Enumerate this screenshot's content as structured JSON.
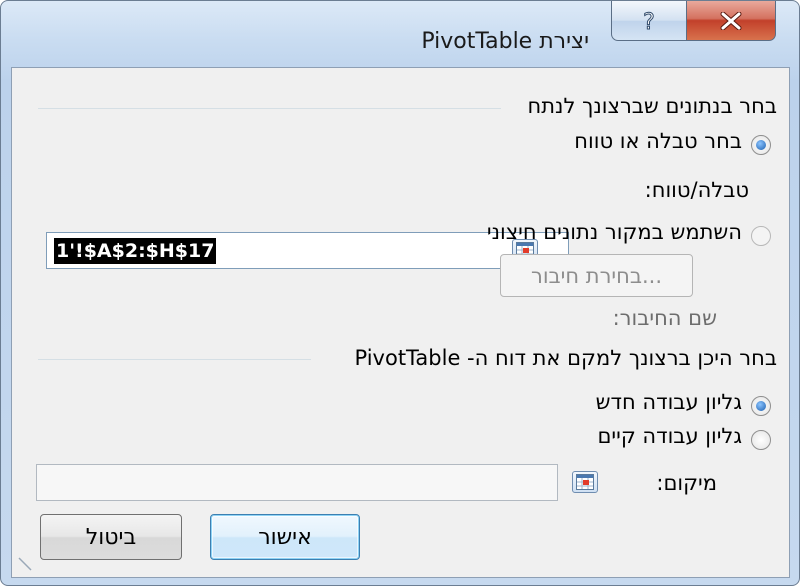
{
  "dialog": {
    "title": "יצירת PivotTable",
    "help_glyph": "?",
    "close_icon": "close-icon",
    "help_icon": "help-icon"
  },
  "data_section": {
    "header": "בחר בנתונים שברצונך לנתח",
    "option_table_range": "בחר טבלה או טווח",
    "table_range_label": "טבלה/טווח:",
    "table_range_value": "1'!$A$2:$H$17",
    "option_external": "השתמש במקור נתונים חיצוני",
    "choose_connection_button": "בחירת חיבור...",
    "connection_name_label": "שם החיבור:"
  },
  "placement_section": {
    "header": "בחר היכן ברצונך למקם את דוח ה- PivotTable",
    "option_new_worksheet": "גליון עבודה חדש",
    "option_existing_worksheet": "גליון עבודה קיים",
    "location_label": "מיקום:",
    "location_value": ""
  },
  "buttons": {
    "ok": "אישור",
    "cancel": "ביטול"
  },
  "state": {
    "selected_data_option": "table_range",
    "selected_placement_option": "new_worksheet"
  },
  "colors": {
    "accent": "#3c7fb1",
    "close_button": "#c2402a"
  }
}
